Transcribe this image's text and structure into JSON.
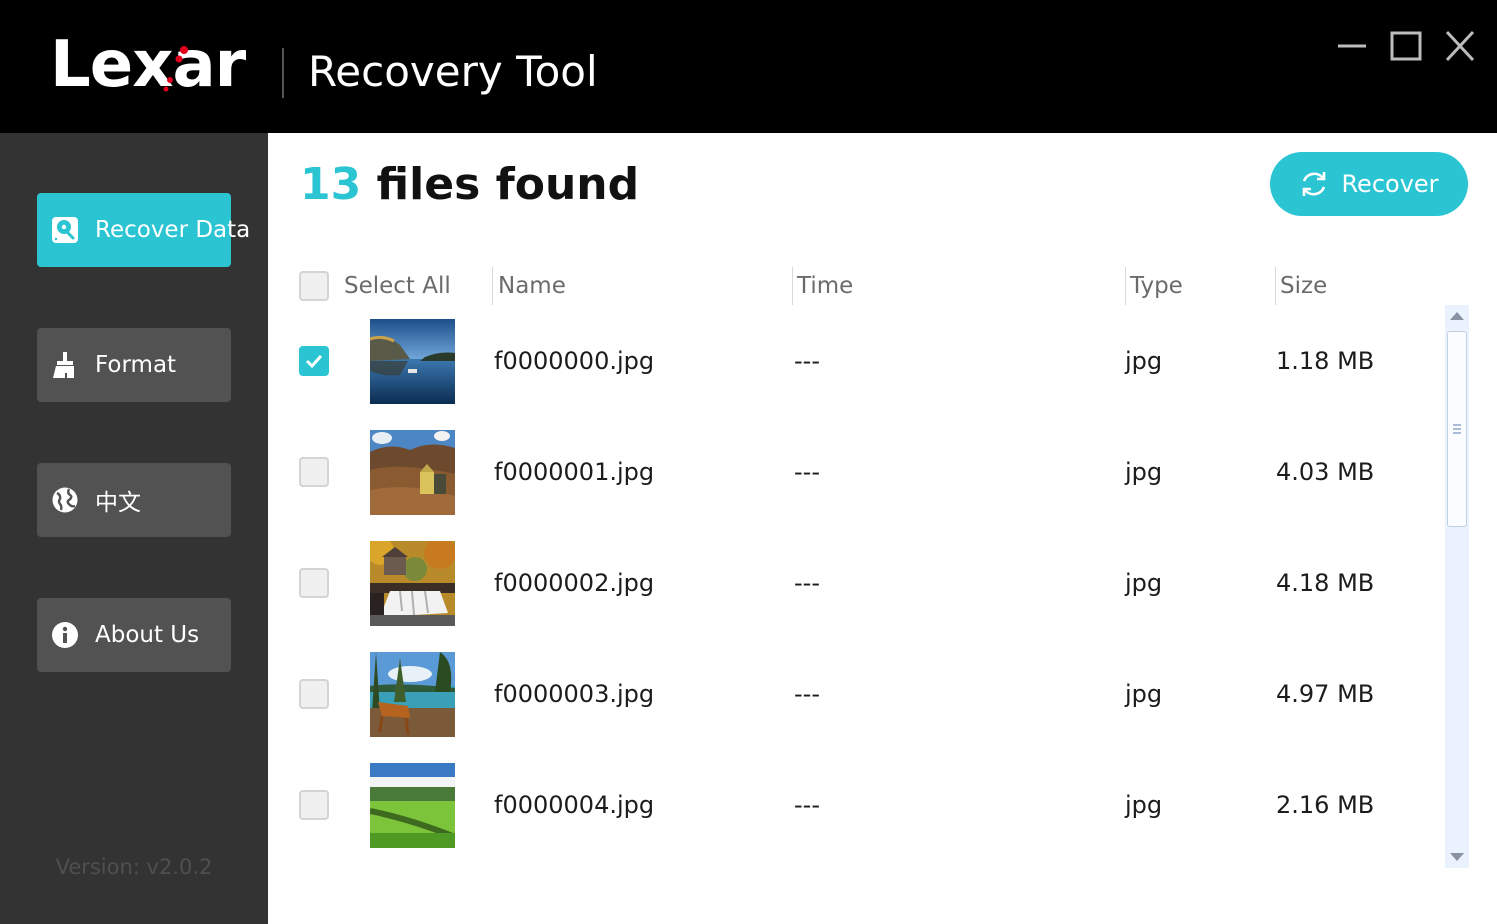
{
  "header": {
    "logo_text": "Lexar",
    "app_title": "Recovery Tool",
    "window_controls": [
      {
        "name": "minimize",
        "icon": "minimize-icon"
      },
      {
        "name": "maximize",
        "icon": "maximize-icon"
      },
      {
        "name": "close",
        "icon": "close-icon"
      }
    ]
  },
  "sidebar": {
    "items": [
      {
        "label": "Recover Data",
        "icon": "recover-disk-icon",
        "active": true
      },
      {
        "label": "Format",
        "icon": "broom-icon",
        "active": false
      },
      {
        "label": "中文",
        "icon": "globe-icon",
        "active": false
      },
      {
        "label": "About Us",
        "icon": "info-icon",
        "active": false
      }
    ],
    "version": "Version: v2.0.2"
  },
  "main": {
    "found_count": "13",
    "found_label": " files found",
    "recover_button": {
      "label": "Recover",
      "icon": "refresh-icon"
    },
    "table": {
      "select_all_label": "Select All",
      "select_all_checked": false,
      "columns": [
        "Name",
        "Time",
        "Type",
        "Size"
      ],
      "rows": [
        {
          "checked": true,
          "thumbnail": "lake-reflection",
          "name": "f0000000.jpg",
          "time": "---",
          "type": "jpg",
          "size": "1.18 MB"
        },
        {
          "checked": false,
          "thumbnail": "mountain-chapel",
          "name": "f0000001.jpg",
          "time": "---",
          "type": "jpg",
          "size": "4.03 MB"
        },
        {
          "checked": false,
          "thumbnail": "autumn-waterfall-mill",
          "name": "f0000002.jpg",
          "time": "---",
          "type": "jpg",
          "size": "4.18 MB"
        },
        {
          "checked": false,
          "thumbnail": "lakeside-bench",
          "name": "f0000003.jpg",
          "time": "---",
          "type": "jpg",
          "size": "4.97 MB"
        },
        {
          "checked": false,
          "thumbnail": "green-meadow",
          "name": "f0000004.jpg",
          "time": "---",
          "type": "jpg",
          "size": "2.16 MB"
        }
      ]
    }
  },
  "colors": {
    "accent": "#2ac4d2",
    "header_bg": "#000000",
    "sidebar_bg": "#333333",
    "nav_button_bg": "#525252",
    "logo_dot": "#e3001b"
  }
}
